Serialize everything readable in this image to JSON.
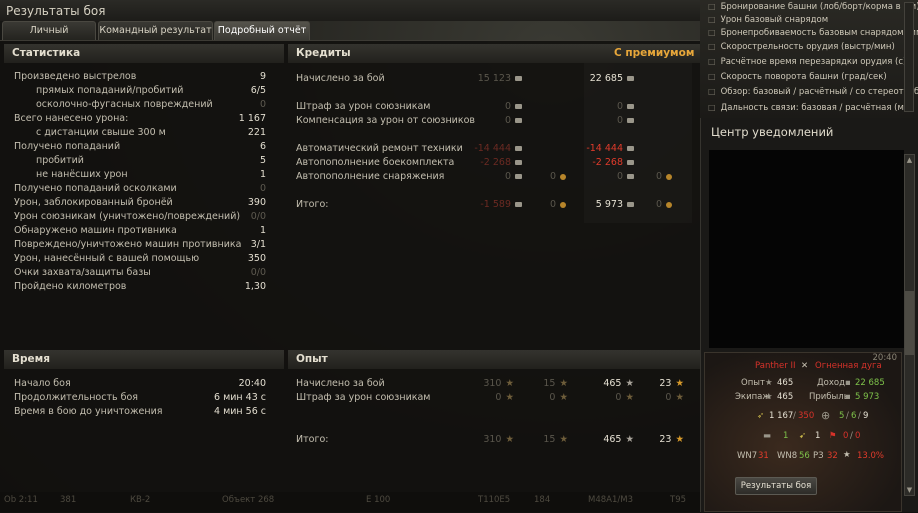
{
  "window": {
    "title": "Результаты боя"
  },
  "tabs": [
    {
      "label": "Личный результат"
    },
    {
      "label": "Командный результат"
    },
    {
      "label": "Подробный отчёт"
    }
  ],
  "stats": {
    "header": "Статистика",
    "rows": [
      {
        "label": "Произведено выстрелов",
        "value": "9"
      },
      {
        "label": "прямых попаданий/пробитий",
        "value": "6/5"
      },
      {
        "label": "осколочно-фугасных повреждений",
        "value": "0"
      },
      {
        "label": "Всего нанесено урона:",
        "value": "1 167"
      },
      {
        "label": "с дистанции свыше 300 м",
        "value": "221"
      },
      {
        "label": "Получено попаданий",
        "value": "6"
      },
      {
        "label": "пробитий",
        "value": "5"
      },
      {
        "label": "не нанёсших урон",
        "value": "1"
      },
      {
        "label": "Получено попаданий осколками",
        "value": "0"
      },
      {
        "label": "Урон, заблокированный бронёй",
        "value": "390"
      },
      {
        "label": "Урон союзникам (уничтожено/повреждений)",
        "value": "0/0"
      },
      {
        "label": "Обнаружено машин противника",
        "value": "1"
      },
      {
        "label": "Повреждено/уничтожено машин противника",
        "value": "3/1"
      },
      {
        "label": "Урон, нанесённый с вашей помощью",
        "value": "350"
      },
      {
        "label": "Очки захвата/защиты базы",
        "value": "0/0"
      },
      {
        "label": "Пройдено километров",
        "value": "1,30"
      }
    ]
  },
  "credits": {
    "header": "Кредиты",
    "premium_label": "С премиумом",
    "rows": [
      {
        "label": "Начислено за бой",
        "base": "15 123",
        "premium": "22 685",
        "gold_base": "",
        "gold_prem": ""
      },
      {
        "label": "Штраф за урон союзникам",
        "base": "0",
        "premium": "0",
        "gold_base": "",
        "gold_prem": ""
      },
      {
        "label": "Компенсация за урон от союзников",
        "base": "0",
        "premium": "0",
        "gold_base": "",
        "gold_prem": ""
      },
      {
        "label": "Автоматический ремонт техники",
        "base": "-14 444",
        "premium": "-14 444",
        "gold_base": "",
        "gold_prem": ""
      },
      {
        "label": "Автопополнение боекомплекта",
        "base": "-2 268",
        "premium": "-2 268",
        "gold_base": "",
        "gold_prem": ""
      },
      {
        "label": "Автопополнение снаряжения",
        "base": "0",
        "premium": "0",
        "gold_base": "0",
        "gold_prem": "0"
      },
      {
        "label": "Итого:",
        "base": "-1 589",
        "premium": "5 973",
        "gold_base": "0",
        "gold_prem": "0"
      }
    ]
  },
  "time": {
    "header": "Время",
    "rows": [
      {
        "label": "Начало боя",
        "value": "20:40"
      },
      {
        "label": "Продолжительность боя",
        "value": "6 мин 43 с"
      },
      {
        "label": "Время в бою до уничтожения",
        "value": "4 мин 56 с"
      }
    ]
  },
  "experience": {
    "header": "Опыт",
    "rows": [
      {
        "label": "Начислено за бой",
        "xp_base": "310",
        "free_base": "15",
        "xp_prem": "465",
        "free_prem": "23"
      },
      {
        "label": "Штраф за урон союзникам",
        "xp_base": "0",
        "free_base": "0",
        "xp_prem": "0",
        "free_prem": "0"
      },
      {
        "label": "Итого:",
        "xp_base": "310",
        "free_base": "15",
        "xp_prem": "465",
        "free_prem": "23"
      }
    ]
  },
  "top_right_list": [
    "Бронирование башни (лоб/борт/корма в мм)",
    "Урон базовый снарядом",
    "Бронепробиваемость базовым снарядом (мм)",
    "Скорострельность орудия (выстр/мин)",
    "Расчётное время перезарядки орудия (с)",
    "Скорость поворота башни (град/сек)",
    "Обзор: базовый / расчётный / со стереотрубой (м)",
    "Дальность связи: базовая / расчётная (м)"
  ],
  "notifications": {
    "title": "Центр уведомлений",
    "card": {
      "time": "20:40",
      "tank": "Panther II",
      "map": "Огненная дуга",
      "exp_label": "Опыт",
      "exp_value": "465",
      "income_label": "Доход",
      "income_value": "22 685",
      "crew_label": "Экипаж",
      "crew_value": "465",
      "profit_label": "Прибыль",
      "profit_value": "5 973",
      "damage": "1 167",
      "damage_blocked": "350",
      "hits": "5",
      "hits2": "6",
      "hits3": "9",
      "assist1": "1",
      "assist2": "1",
      "kills": "0",
      "kills_dim": "0",
      "wn7_label": "WN7",
      "wn7": "31",
      "wn8_label": "WN8",
      "wn8": "56",
      "rz_label": "РЗ",
      "rz": "32",
      "pct": "13.0%",
      "button": "Результаты боя"
    }
  },
  "bottom_bar": [
    "Ob 2:11",
    "381",
    "КВ-2",
    "Объект 268",
    "Е 100",
    "Т110Е5",
    "184",
    "M48A1/M3",
    "Т95"
  ],
  "colors": {
    "accent_gold": "#d79a2a",
    "negative": "#e13b2b",
    "positive": "#7ec24a"
  }
}
